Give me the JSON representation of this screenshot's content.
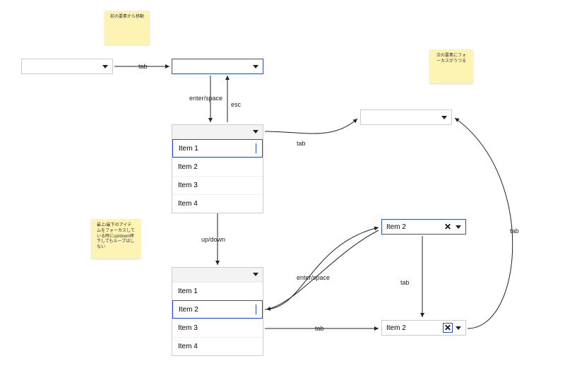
{
  "stickies": {
    "top": "前の要素から移動",
    "right": "次の要素にフォーカスがうつる",
    "left": "最上/最下のアイテムをフォーカスしている時にup/down押下してもループはしない"
  },
  "labels": {
    "tab1": "tab",
    "enter_space1": "enter/space",
    "esc": "esc",
    "tab2": "tab",
    "up_down": "up/down",
    "enter_space2": "enter/space",
    "tab3": "tab",
    "tab4": "tab",
    "tab5": "tab"
  },
  "selectA": {
    "value": ""
  },
  "selectB": {
    "value": ""
  },
  "selectC": {
    "value": ""
  },
  "selectD": {
    "value": "Item 2"
  },
  "selectE": {
    "value": "Item 2"
  },
  "listbox1": {
    "items": [
      "Item 1",
      "Item 2",
      "Item 3",
      "Item 4"
    ],
    "focused": 0
  },
  "listbox2": {
    "items": [
      "Item 1",
      "Item 2",
      "Item 3",
      "Item 4"
    ],
    "focused": 1
  },
  "icons": {
    "close": "✕"
  }
}
